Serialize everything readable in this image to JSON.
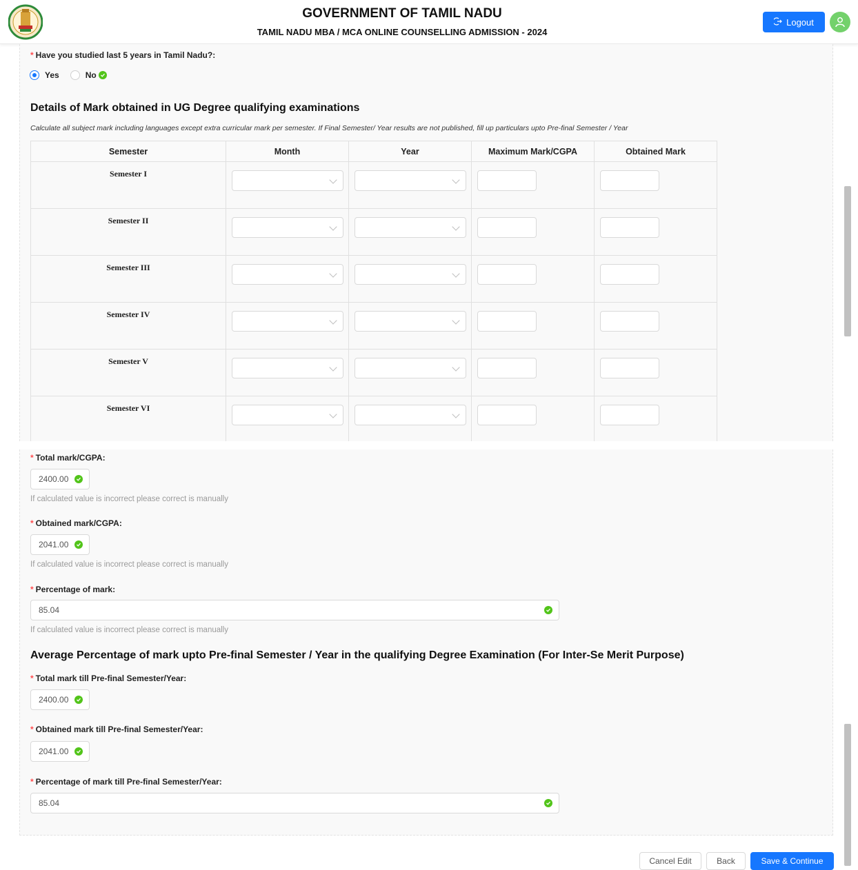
{
  "header": {
    "title": "GOVERNMENT OF TAMIL NADU",
    "subtitle": "TAMIL NADU MBA / MCA ONLINE COUNSELLING ADMISSION - 2024",
    "logout_label": "Logout"
  },
  "residency": {
    "question": "Have you studied last 5 years in Tamil Nadu?:",
    "options": [
      "Yes",
      "No"
    ],
    "selected": "Yes"
  },
  "ug_marks": {
    "title": "Details of Mark obtained in UG Degree qualifying examinations",
    "note": "Calculate all subject mark including languages except extra curricular mark per semester. If Final Semester/ Year results are not published, fill up particulars upto Pre-final Semester / Year",
    "columns": [
      "Semester",
      "Month",
      "Year",
      "Maximum Mark/CGPA",
      "Obtained Mark"
    ],
    "rows": [
      "Semester I",
      "Semester II",
      "Semester III",
      "Semester IV",
      "Semester V",
      "Semester VI"
    ]
  },
  "totals": {
    "total_label": "Total mark/CGPA",
    "total_value": "2400.00",
    "obtained_label": "Obtained mark/CGPA",
    "obtained_value": "2041.00",
    "percentage_label": "Percentage of mark",
    "percentage_value": "85.04",
    "hint": "If calculated value is incorrect please correct is manually"
  },
  "prefinal": {
    "title": "Average Percentage of mark upto Pre-final Semester / Year in the qualifying Degree Examination (For Inter-Se Merit Purpose)",
    "total_label": "Total mark till Pre-final Semester/Year",
    "total_value": "2400.00",
    "obtained_label": "Obtained mark till Pre-final Semester/Year",
    "obtained_value": "2041.00",
    "percentage_label": "Percentage of mark till Pre-final Semester/Year",
    "percentage_value": "85.04"
  },
  "actions": {
    "cancel_label": "Cancel Edit",
    "back_label": "Back",
    "save_label": "Save & Continue"
  },
  "colors": {
    "primary": "#1677ff",
    "success": "#52c41a",
    "required": "#ff4d4f"
  }
}
